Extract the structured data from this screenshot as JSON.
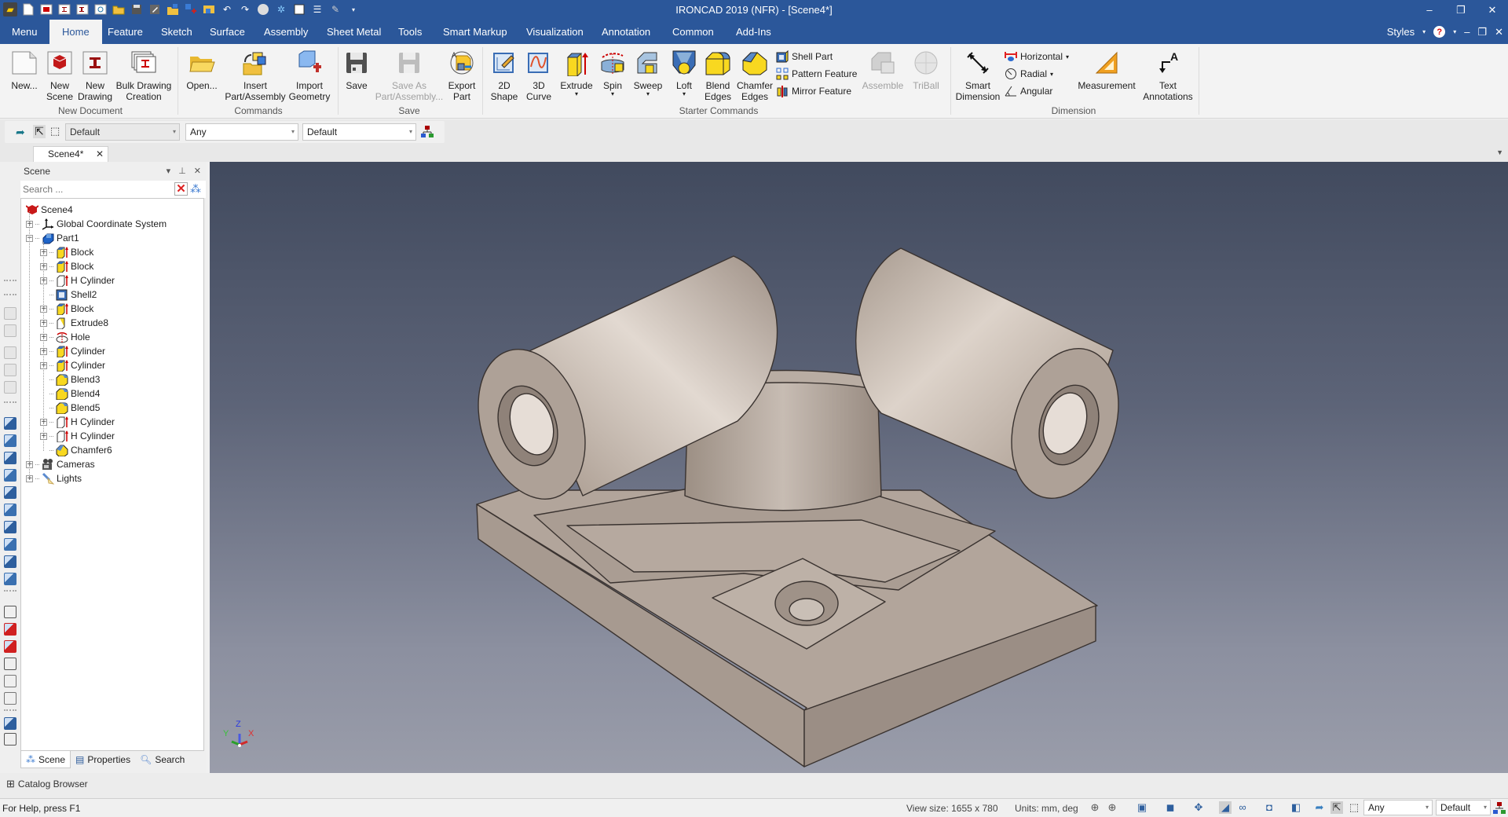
{
  "window": {
    "title": "IRONCAD 2019 (NFR) - [Scene4*]",
    "controls": [
      "minimize",
      "restore",
      "close"
    ]
  },
  "quick_access": [
    "app-logo-icon",
    "new-icon",
    "new-scene-icon",
    "new-drawing-icon",
    "bulk-drawing-icon",
    "insert-icon",
    "open-icon",
    "save-icon",
    "edit-icon",
    "folder-insert-icon",
    "add-geometry-icon",
    "export-icon",
    "undo-icon",
    "redo-icon",
    "render-sphere-icon",
    "sparkle-tree-icon",
    "film-icon",
    "list-icon",
    "brush-icon",
    "customize-icon"
  ],
  "ribbon_tabs": [
    {
      "label": "Menu"
    },
    {
      "label": "Home",
      "active": true
    },
    {
      "label": "Feature"
    },
    {
      "label": "Sketch"
    },
    {
      "label": "Surface"
    },
    {
      "label": "Assembly"
    },
    {
      "label": "Sheet Metal"
    },
    {
      "label": "Tools"
    },
    {
      "label": "Smart Markup"
    },
    {
      "label": "Visualization"
    },
    {
      "label": "Annotation"
    },
    {
      "label": "Common"
    },
    {
      "label": "Add-Ins"
    }
  ],
  "tab_right": {
    "styles": "Styles"
  },
  "ribbon": {
    "groups": {
      "new_document": "New Document",
      "commands": "Commands",
      "save": "Save",
      "starter": "Starter Commands",
      "dimension": "Dimension"
    },
    "buttons": {
      "new": "New...",
      "new_scene": [
        "New",
        "Scene"
      ],
      "new_drawing": [
        "New",
        "Drawing"
      ],
      "bulk": [
        "Bulk Drawing",
        "Creation"
      ],
      "open": "Open...",
      "insert": [
        "Insert",
        "Part/Assembly"
      ],
      "import": [
        "Import",
        "Geometry"
      ],
      "save": "Save",
      "save_as": [
        "Save As",
        "Part/Assembly..."
      ],
      "export": [
        "Export",
        "Part"
      ],
      "shape2d": [
        "2D",
        "Shape"
      ],
      "curve3d": [
        "3D",
        "Curve"
      ],
      "extrude": "Extrude",
      "spin": "Spin",
      "sweep": "Sweep",
      "loft": "Loft",
      "blend": [
        "Blend",
        "Edges"
      ],
      "chamfer": [
        "Chamfer",
        "Edges"
      ],
      "shell": "Shell Part",
      "pattern": "Pattern Feature",
      "mirror": "Mirror Feature",
      "assemble": "Assemble",
      "triball": "TriBall",
      "smart_dim": [
        "Smart",
        "Dimension"
      ],
      "horizontal": "Horizontal",
      "radial": "Radial",
      "angular": "Angular",
      "measurement": "Measurement",
      "text_ann": [
        "Text",
        "Annotations"
      ]
    }
  },
  "selection_bar": {
    "combo1": "Default",
    "combo2": "Any",
    "combo3": "Default"
  },
  "doc_tab": {
    "label": "Scene4*"
  },
  "scene_panel": {
    "title": "Scene",
    "search_placeholder": "Search ...",
    "tree": [
      {
        "label": "Scene4",
        "level": 0,
        "icon": "scene-icon",
        "expander": ""
      },
      {
        "label": "Global Coordinate System",
        "level": 1,
        "icon": "coordinate-system-icon",
        "expander": "+"
      },
      {
        "label": "Part1",
        "level": 1,
        "icon": "part-icon",
        "expander": "-"
      },
      {
        "label": "Block",
        "level": 2,
        "icon": "block-icon",
        "expander": "+"
      },
      {
        "label": "Block",
        "level": 2,
        "icon": "block-icon",
        "expander": "+"
      },
      {
        "label": "H Cylinder",
        "level": 2,
        "icon": "h-cylinder-icon",
        "expander": "+"
      },
      {
        "label": "Shell2",
        "level": 2,
        "icon": "shell-icon",
        "expander": ""
      },
      {
        "label": "Block",
        "level": 2,
        "icon": "block-icon",
        "expander": "+"
      },
      {
        "label": "Extrude8",
        "level": 2,
        "icon": "extrude-icon",
        "expander": "+"
      },
      {
        "label": "Hole",
        "level": 2,
        "icon": "hole-icon",
        "expander": "+"
      },
      {
        "label": "Cylinder",
        "level": 2,
        "icon": "cylinder-icon",
        "expander": "+"
      },
      {
        "label": "Cylinder",
        "level": 2,
        "icon": "cylinder-icon",
        "expander": "+"
      },
      {
        "label": "Blend3",
        "level": 2,
        "icon": "blend-icon",
        "expander": ""
      },
      {
        "label": "Blend4",
        "level": 2,
        "icon": "blend-icon",
        "expander": ""
      },
      {
        "label": "Blend5",
        "level": 2,
        "icon": "blend-icon",
        "expander": ""
      },
      {
        "label": "H Cylinder",
        "level": 2,
        "icon": "h-cylinder-icon",
        "expander": "+"
      },
      {
        "label": "H Cylinder",
        "level": 2,
        "icon": "h-cylinder-icon",
        "expander": "+"
      },
      {
        "label": "Chamfer6",
        "level": 2,
        "icon": "chamfer-icon",
        "expander": ""
      },
      {
        "label": "Cameras",
        "level": 1,
        "icon": "camera-icon",
        "expander": "+"
      },
      {
        "label": "Lights",
        "level": 1,
        "icon": "light-icon",
        "expander": "+"
      }
    ],
    "tabs": [
      {
        "label": "Scene",
        "active": true
      },
      {
        "label": "Properties"
      },
      {
        "label": "Search"
      }
    ]
  },
  "viewport": {
    "triad": {
      "x": "X",
      "y": "Y",
      "z": "Z"
    }
  },
  "catalog": {
    "label": "Catalog Browser"
  },
  "status": {
    "help": "For Help, press F1",
    "view_size": "View size: 1655 x  780",
    "units": "Units: mm, deg",
    "combo1": "Any",
    "combo2": "Default"
  },
  "colors": {
    "brand": "#2b579a",
    "viewport_top": "#414a5e",
    "viewport_bottom": "#9a9daa",
    "part": "#b7aaa0"
  }
}
